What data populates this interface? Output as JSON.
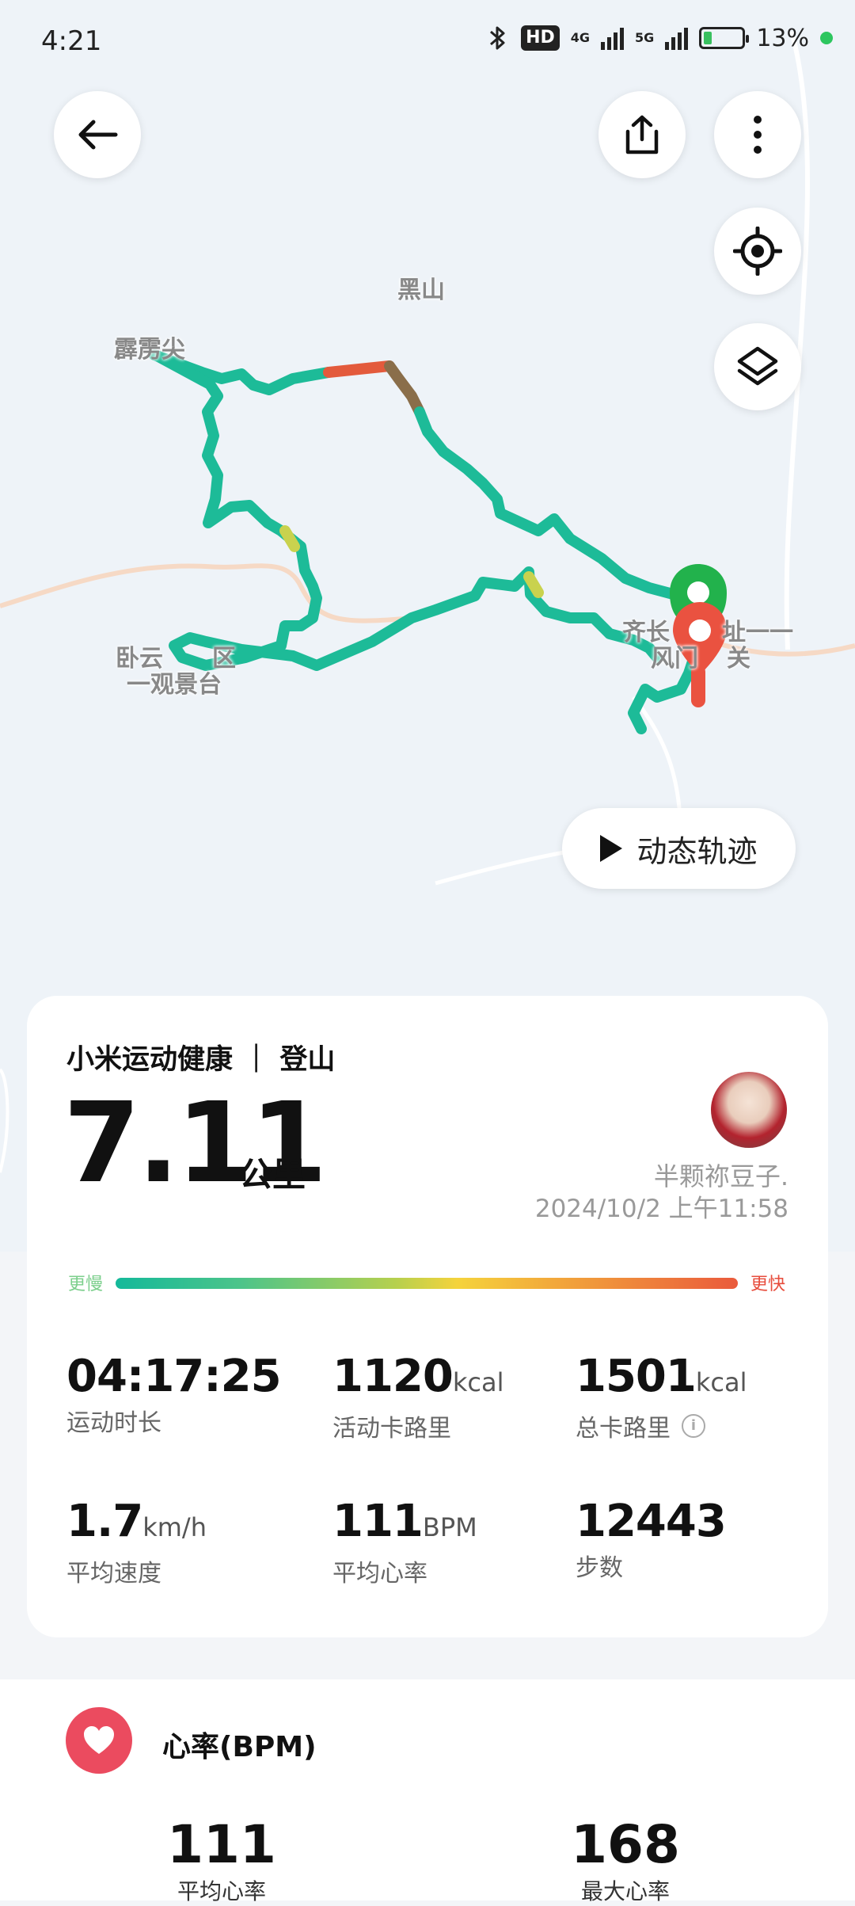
{
  "status_bar": {
    "time": "4:21",
    "hd_badge": "HD",
    "network_1": "4G",
    "network_2": "5G",
    "battery_text": "13%",
    "battery_level": 0.13,
    "icons": [
      "bluetooth-icon",
      "signal-icon",
      "battery-icon"
    ]
  },
  "toolbar": {
    "back_icon": "arrow-left-icon",
    "share_icon": "share-icon",
    "more_icon": "more-vertical-icon",
    "locate_icon": "locate-icon",
    "layers_icon": "layers-icon"
  },
  "map": {
    "labels": {
      "heishan": "黑山",
      "pilijian": "霹雳尖",
      "woyun": "卧云",
      "woyun_2": "区",
      "woyun_3": "一观景台",
      "qichang": "齐长",
      "qichang_2": "址一一",
      "fengmen": "风门",
      "fengmen_2": "关"
    },
    "track_colors": [
      "#1dbb98",
      "#e35a3c",
      "#8a6e4a",
      "#c9d24e"
    ],
    "start_marker_color": "#22b24c",
    "end_marker_color": "#ea5240",
    "dynamic_track_label": "动态轨迹"
  },
  "summary": {
    "app_label": "小米运动健康 ｜ 登山",
    "distance": "7.11",
    "distance_unit": "公里",
    "user_name": "半颗祢豆子.",
    "datetime": "2024/10/2  上午11:58",
    "pace_slow_label": "更慢",
    "pace_fast_label": "更快"
  },
  "stats": [
    {
      "value": "04:17:25",
      "unit": "",
      "label": "运动时长"
    },
    {
      "value": "1120",
      "unit": "kcal",
      "label": "活动卡路里"
    },
    {
      "value": "1501",
      "unit": "kcal",
      "label": "总卡路里"
    },
    {
      "value": "1.7",
      "unit": "km/h",
      "label": "平均速度"
    },
    {
      "value": "111",
      "unit": "BPM",
      "label": "平均心率"
    },
    {
      "value": "12443",
      "unit": "",
      "label": "步数"
    }
  ],
  "heart_rate": {
    "title": "心率(BPM)",
    "avg_value": "111",
    "avg_label": "平均心率",
    "max_value": "168",
    "max_label": "最大心率",
    "icon": "heart-icon"
  },
  "accent_colors": {
    "track_green": "#1dbb98",
    "heart_red": "#eb4b5f",
    "start_green": "#22b24c",
    "end_red": "#ea5240"
  }
}
